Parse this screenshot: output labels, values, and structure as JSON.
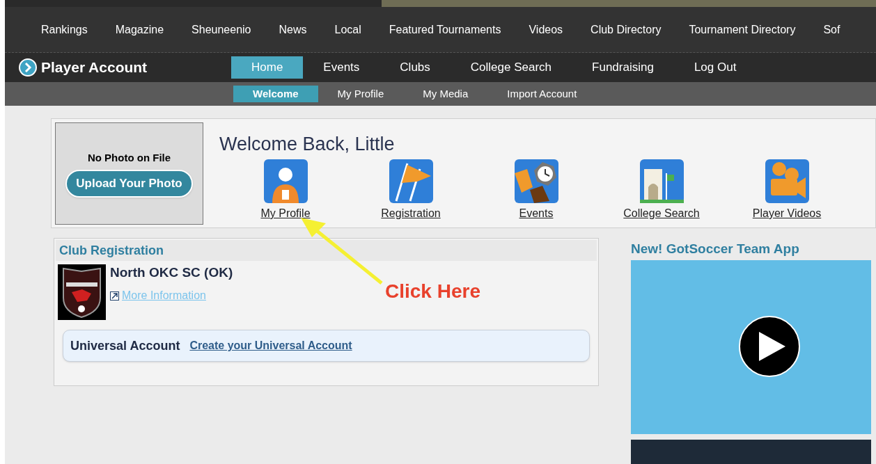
{
  "top_nav": [
    "Rankings",
    "Magazine",
    "Sheuneenio",
    "News",
    "Local",
    "Featured Tournaments",
    "Videos",
    "Club Directory",
    "Tournament Directory",
    "Sof"
  ],
  "account_bar": {
    "title": "Player Account",
    "tabs": [
      {
        "label": "Home",
        "selected": true
      },
      {
        "label": "Events",
        "selected": false
      },
      {
        "label": "Clubs",
        "selected": false
      },
      {
        "label": "College Search",
        "selected": false
      },
      {
        "label": "Fundraising",
        "selected": false
      },
      {
        "label": "Log Out",
        "selected": false
      }
    ]
  },
  "sub_tabs": [
    {
      "label": "Welcome",
      "selected": true
    },
    {
      "label": "My Profile",
      "selected": false
    },
    {
      "label": "My Media",
      "selected": false
    },
    {
      "label": "Import Account",
      "selected": false
    }
  ],
  "photo": {
    "caption": "No Photo on File",
    "button": "Upload Your Photo"
  },
  "welcome": "Welcome Back, Little",
  "shortcuts": [
    {
      "label": "My Profile",
      "kind": "profile"
    },
    {
      "label": "Registration",
      "kind": "registration"
    },
    {
      "label": "Events",
      "kind": "events"
    },
    {
      "label": "College Search",
      "kind": "college"
    },
    {
      "label": "Player Videos",
      "kind": "videos"
    }
  ],
  "club_registration": {
    "title": "Club Registration",
    "club_name": "North OKC SC (OK)",
    "link": "More Information",
    "universal_account": {
      "label": "Universal Account",
      "link": "Create your Universal Account"
    }
  },
  "annotation": {
    "text": "Click Here"
  },
  "team_app": {
    "title": "New! GotSoccer Team App"
  }
}
